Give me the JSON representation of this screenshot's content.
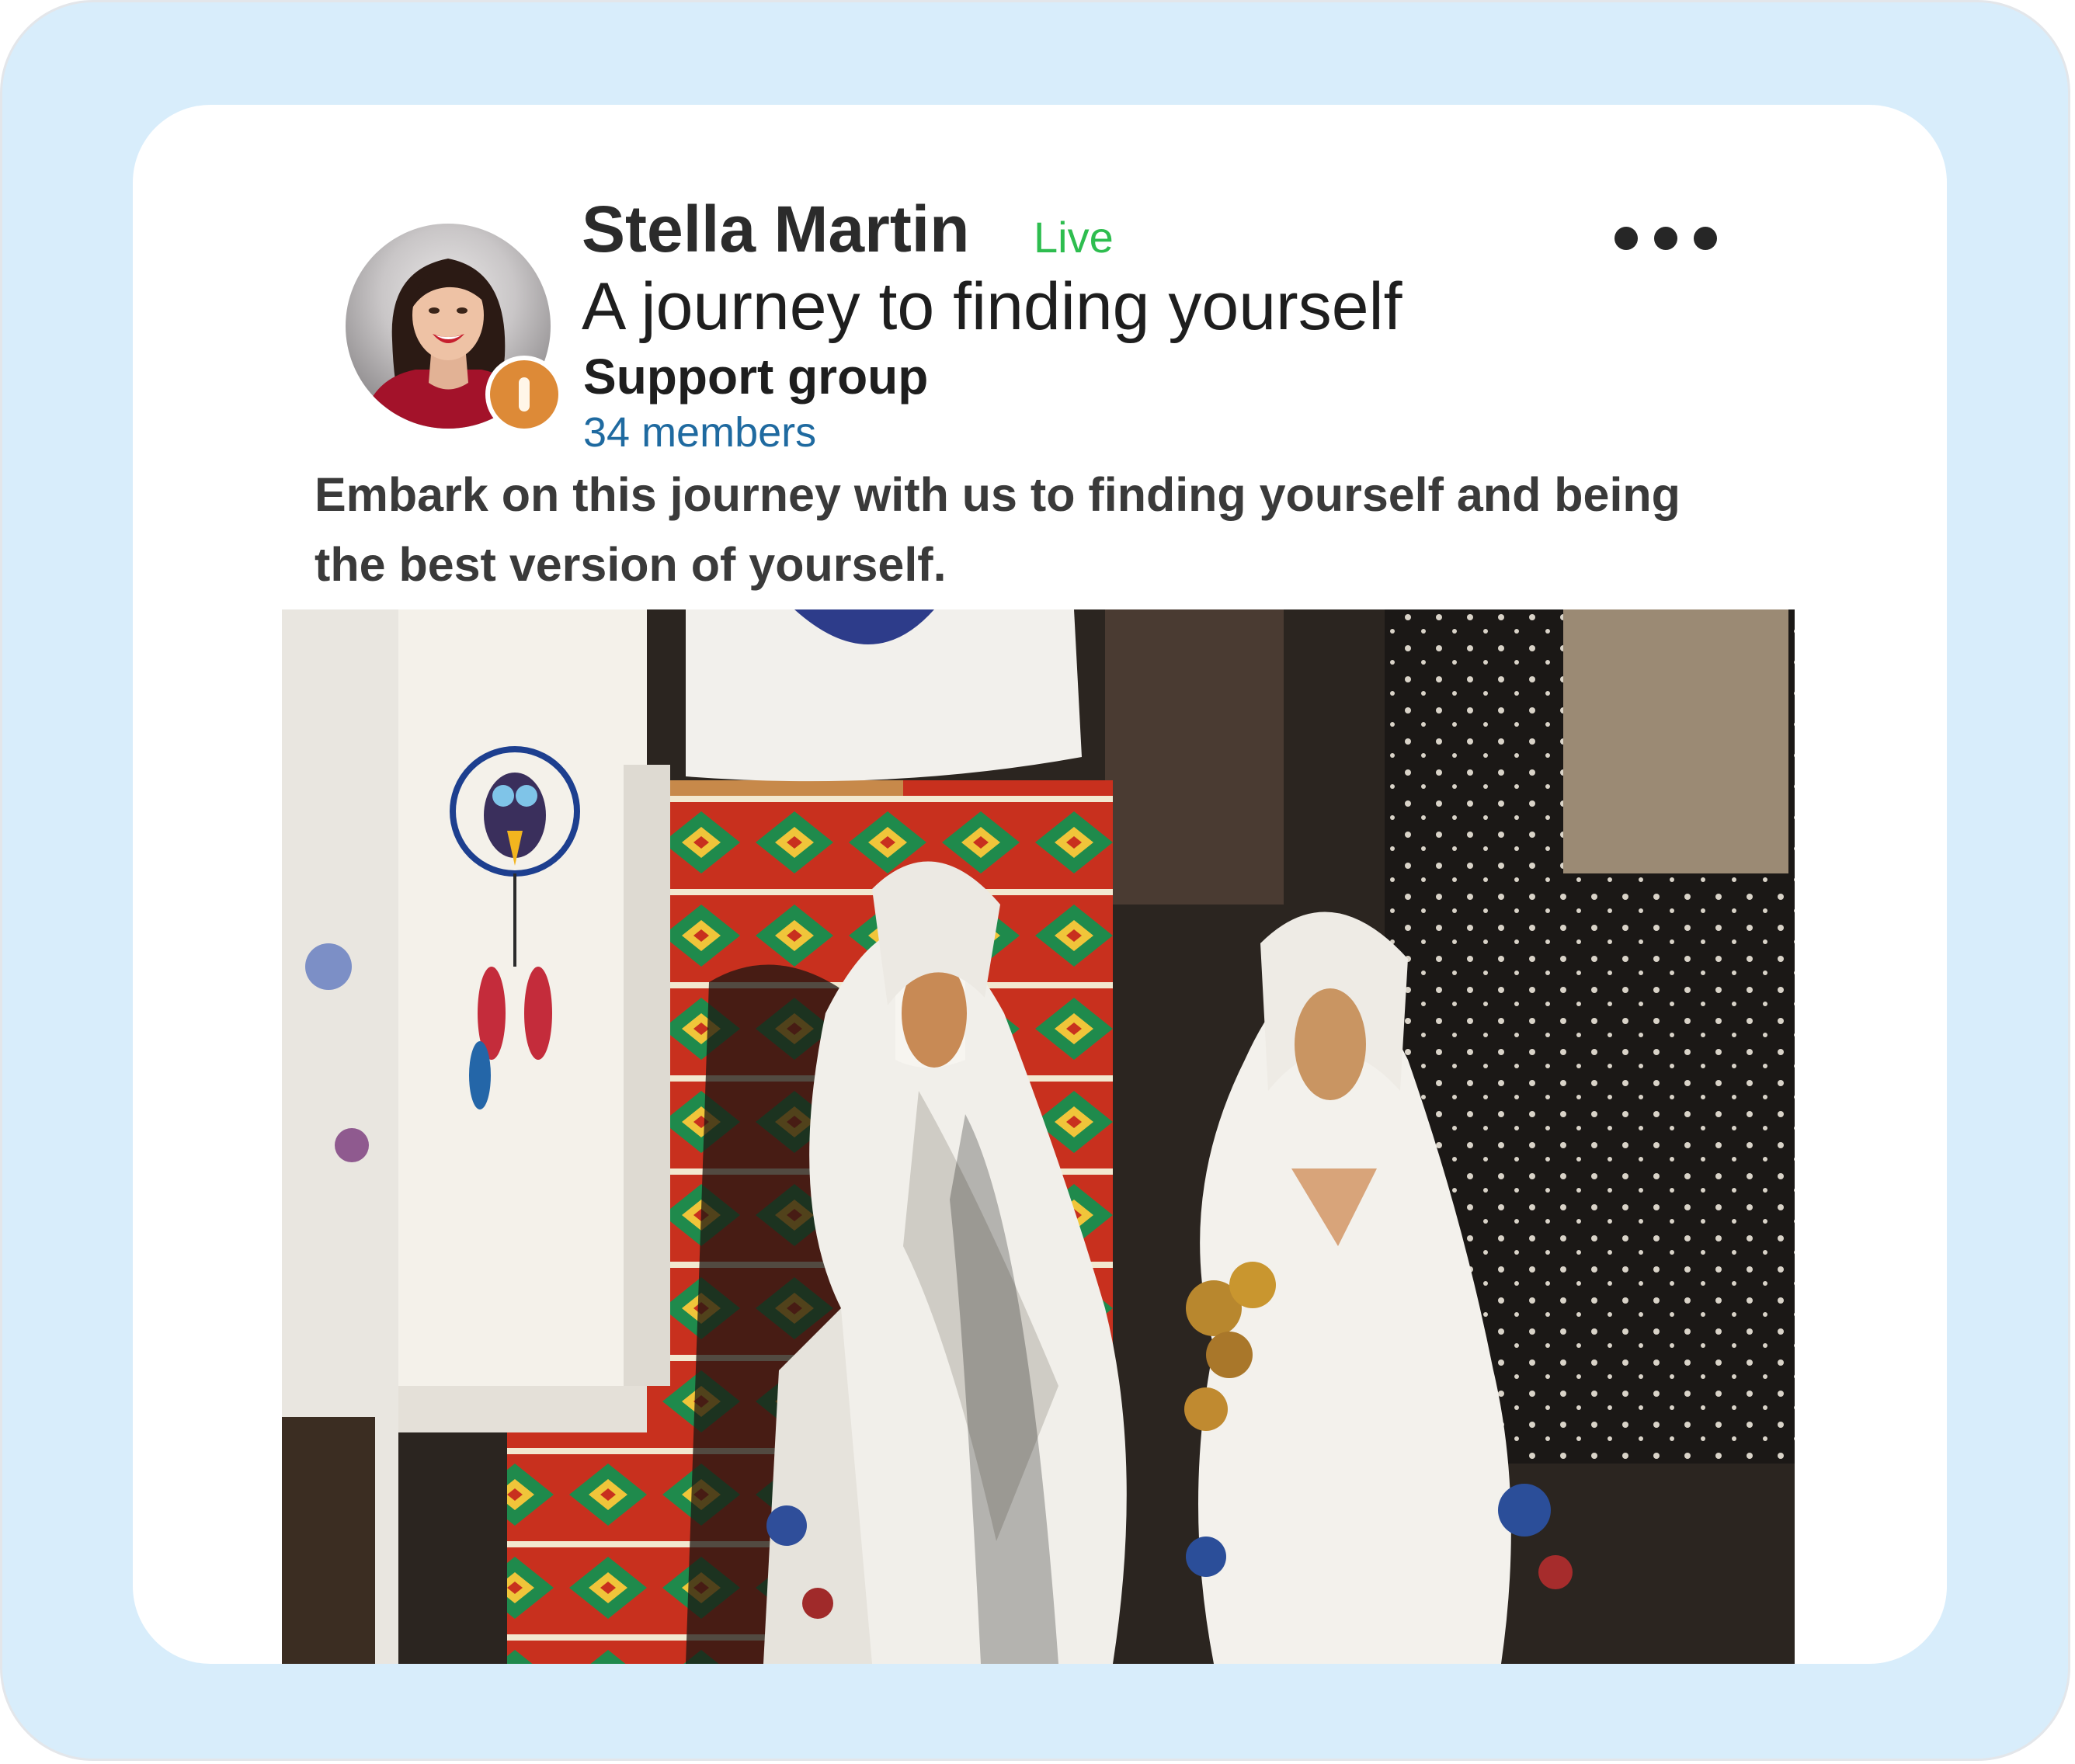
{
  "post": {
    "author_name": "Stella Martin",
    "status": "Live",
    "title": "A journey to finding yourself",
    "group_type": "Support group",
    "members": "34 members",
    "description": "Embark on this journey with us to finding yourself and being the best version of yourself."
  },
  "icons": {
    "more": "more-horizontal-icon",
    "badge": "rank-badge-icon"
  },
  "colors": {
    "frame_background": "#d8edfb",
    "card_background": "#ffffff",
    "live_status": "#2ebd4f",
    "members_link": "#1f6aa0",
    "badge": "#dd8a37"
  }
}
